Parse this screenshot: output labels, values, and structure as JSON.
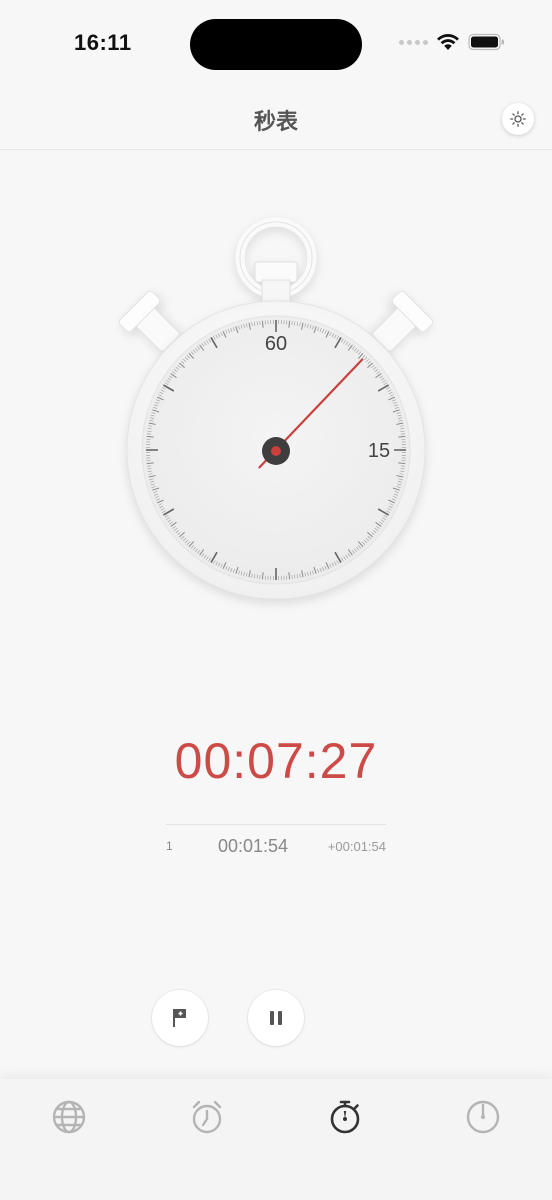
{
  "status_bar": {
    "time": "16:11"
  },
  "header": {
    "title": "秒表",
    "theme_icon": "sun-icon"
  },
  "stopwatch_dial": {
    "label_top": "60",
    "label_right": "15",
    "hand_seconds": 7.27,
    "hand_color": "#c9403d"
  },
  "display": {
    "elapsed": "00:07:27",
    "color": "#cc4b46"
  },
  "laps": [
    {
      "index": "1",
      "time": "00:01:54",
      "diff": "+00:01:54"
    }
  ],
  "controls": {
    "lap_icon": "flag-icon",
    "pause_icon": "pause-icon"
  },
  "tabs": [
    {
      "name": "world-clock",
      "icon": "globe-icon",
      "active": false
    },
    {
      "name": "alarm",
      "icon": "alarm-clock-icon",
      "active": false
    },
    {
      "name": "stopwatch",
      "icon": "stopwatch-icon",
      "active": true
    },
    {
      "name": "timer",
      "icon": "timer-icon",
      "active": false
    }
  ]
}
